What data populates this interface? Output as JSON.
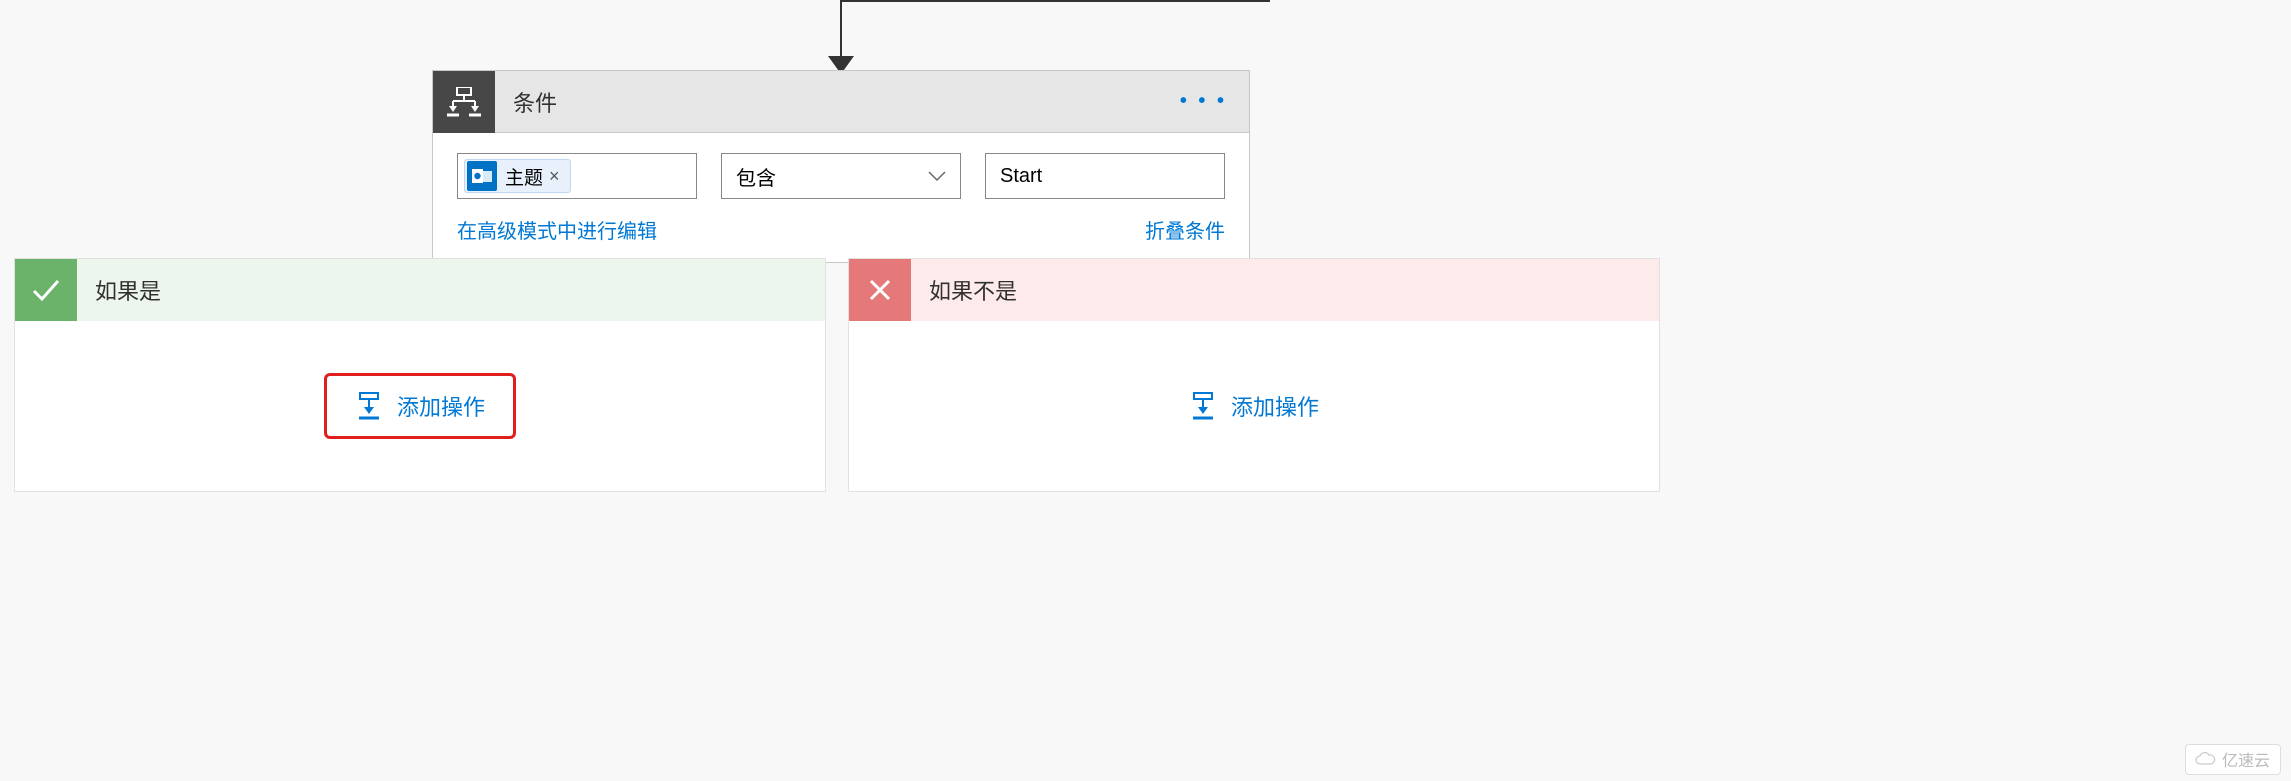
{
  "condition": {
    "title": "条件",
    "subject_token": "主题",
    "operator": "包含",
    "value": "Start",
    "edit_advanced": "在高级模式中进行编辑",
    "collapse": "折叠条件",
    "more": "• • •"
  },
  "branches": {
    "yes_label": "如果是",
    "no_label": "如果不是",
    "add_action": "添加操作"
  },
  "watermark": "亿速云"
}
